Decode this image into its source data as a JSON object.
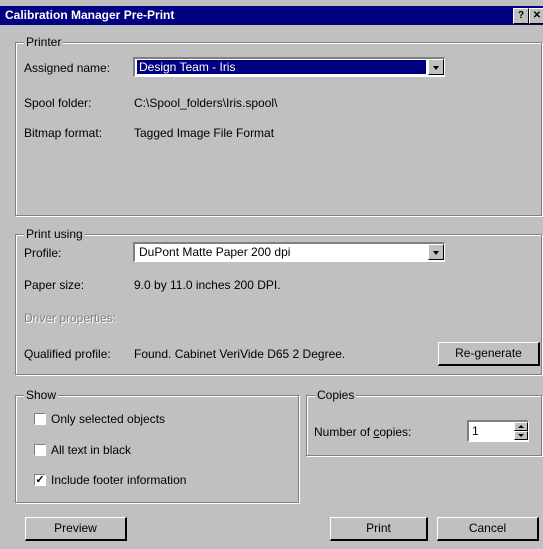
{
  "window": {
    "title": "Calibration Manager Pre-Print",
    "help_label": "?",
    "close_label": "✕"
  },
  "printer": {
    "legend": "Printer",
    "assigned_name_label": "Assigned name:",
    "assigned_name_value": "Design Team - Iris",
    "spool_label": "Spool folder:",
    "spool_value": "C:\\Spool_folders\\Iris.spool\\",
    "bitmap_label": "Bitmap format:",
    "bitmap_value": "Tagged Image File Format"
  },
  "print_using": {
    "legend": "Print using",
    "profile_label": "Profile:",
    "profile_value": "DuPont Matte Paper 200 dpi",
    "paper_label": "Paper size:",
    "paper_value": "9.0 by 11.0 inches 200 DPI.",
    "driver_label": "Driver properties:",
    "qualified_label": "Qualified profile:",
    "qualified_value": "Found. Cabinet VeriVide D65 2 Degree.",
    "regenerate_label": "Re-generate"
  },
  "show": {
    "legend": "Show",
    "options": [
      {
        "label": "Only selected objects",
        "checked": false
      },
      {
        "label": "All text in black",
        "checked": false
      },
      {
        "label": "Include footer information",
        "checked": true
      }
    ]
  },
  "copies": {
    "legend": "Copies",
    "label_prefix": "Number of ",
    "label_accel": "c",
    "label_suffix": "opies:",
    "value": "1"
  },
  "buttons": {
    "preview": "Preview",
    "print": "Print",
    "cancel": "Cancel"
  }
}
